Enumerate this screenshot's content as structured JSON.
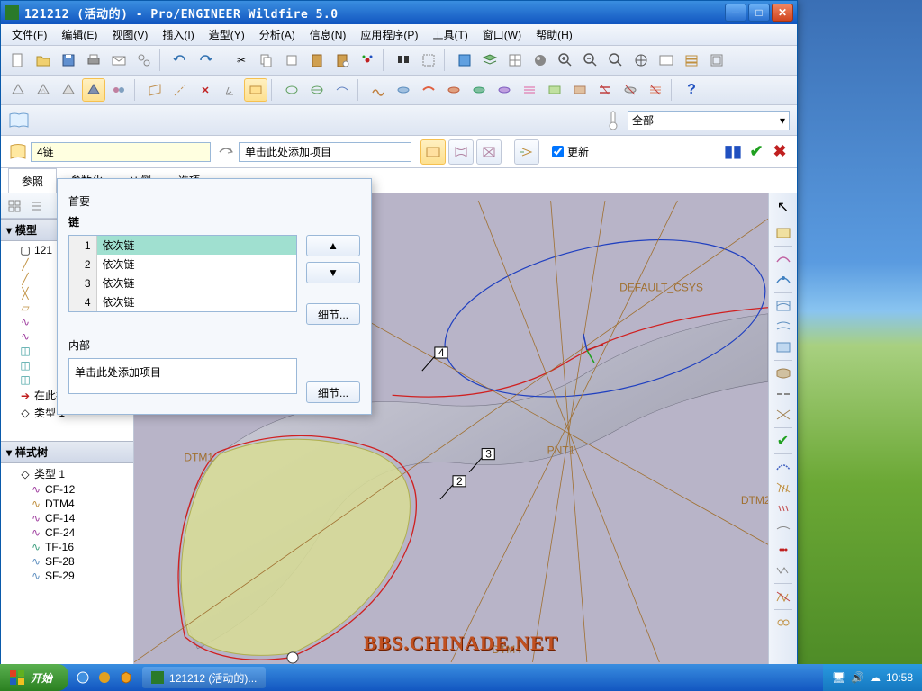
{
  "window": {
    "title": "121212 (活动的) - Pro/ENGINEER Wildfire 5.0"
  },
  "menu": {
    "items": [
      {
        "label": "文件",
        "key": "F"
      },
      {
        "label": "编辑",
        "key": "E"
      },
      {
        "label": "视图",
        "key": "V"
      },
      {
        "label": "插入",
        "key": "I"
      },
      {
        "label": "造型",
        "key": "Y"
      },
      {
        "label": "分析",
        "key": "A"
      },
      {
        "label": "信息",
        "key": "N"
      },
      {
        "label": "应用程序",
        "key": "P"
      },
      {
        "label": "工具",
        "key": "T"
      },
      {
        "label": "窗口",
        "key": "W"
      },
      {
        "label": "帮助",
        "key": "H"
      }
    ]
  },
  "filter": {
    "selected": "全部"
  },
  "feature": {
    "chain_count": "4链",
    "add_item_placeholder": "单击此处添加项目",
    "update_label": "更新"
  },
  "tabs": [
    "参照",
    "参数化",
    "N 侧",
    "选项"
  ],
  "popup": {
    "primary_label": "首要",
    "chain_label": "链",
    "chains": [
      {
        "n": "1",
        "name": "依次链"
      },
      {
        "n": "2",
        "name": "依次链"
      },
      {
        "n": "3",
        "name": "依次链"
      },
      {
        "n": "4",
        "name": "依次链"
      }
    ],
    "details_btn": "细节...",
    "inner_label": "内部",
    "inner_placeholder": "单击此处添加项目"
  },
  "model_tree": {
    "header": "模型",
    "root": "121",
    "insert_here": "在此插入",
    "style_type": "类型 1"
  },
  "style_tree": {
    "header": "样式树",
    "root": "类型 1",
    "items": [
      "CF-12",
      "DTM4",
      "CF-14",
      "CF-24",
      "TF-16",
      "SF-28",
      "SF-29"
    ]
  },
  "viewport": {
    "csys": "DEFAULT_CSYS",
    "dtm_labels": [
      "DTM1",
      "DTM2",
      "DTM4",
      "PNT1"
    ],
    "pt_labels": [
      "2",
      "3",
      "4"
    ]
  },
  "taskbar": {
    "start": "开始",
    "task": "121212 (活动的)...",
    "time": "10:58"
  },
  "watermark": "BBS.CHINADE.NET"
}
